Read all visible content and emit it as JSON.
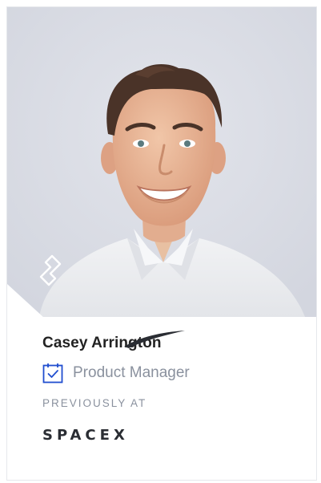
{
  "profile": {
    "name": "Casey Arrington",
    "role": "Product Manager",
    "previously_label": "PREVIOUSLY AT",
    "company": "SPACEX"
  },
  "colors": {
    "photo_background": "#d9dbe3",
    "name_text": "#222222",
    "muted_text": "#8a919e",
    "role_icon": "#204ecf"
  },
  "icons": {
    "role": "calendar-check-icon",
    "brand": "toptal-logo-icon"
  }
}
